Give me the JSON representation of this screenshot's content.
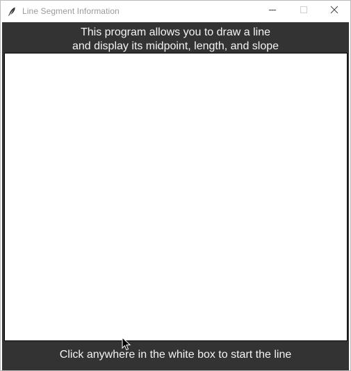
{
  "window": {
    "title": "Line Segment Information",
    "icons": {
      "app": "feather-icon",
      "minimize": "minimize-icon",
      "maximize": "maximize-icon",
      "close": "close-icon"
    }
  },
  "header": {
    "line1": "This program allows you to draw a line",
    "line2": "and display its midpoint, length, and slope"
  },
  "footer": {
    "instruction": "Click anywhere in the white box to start the line"
  },
  "colors": {
    "background": "#333333",
    "canvas": "#ffffff",
    "text": "#f4f4f4"
  }
}
